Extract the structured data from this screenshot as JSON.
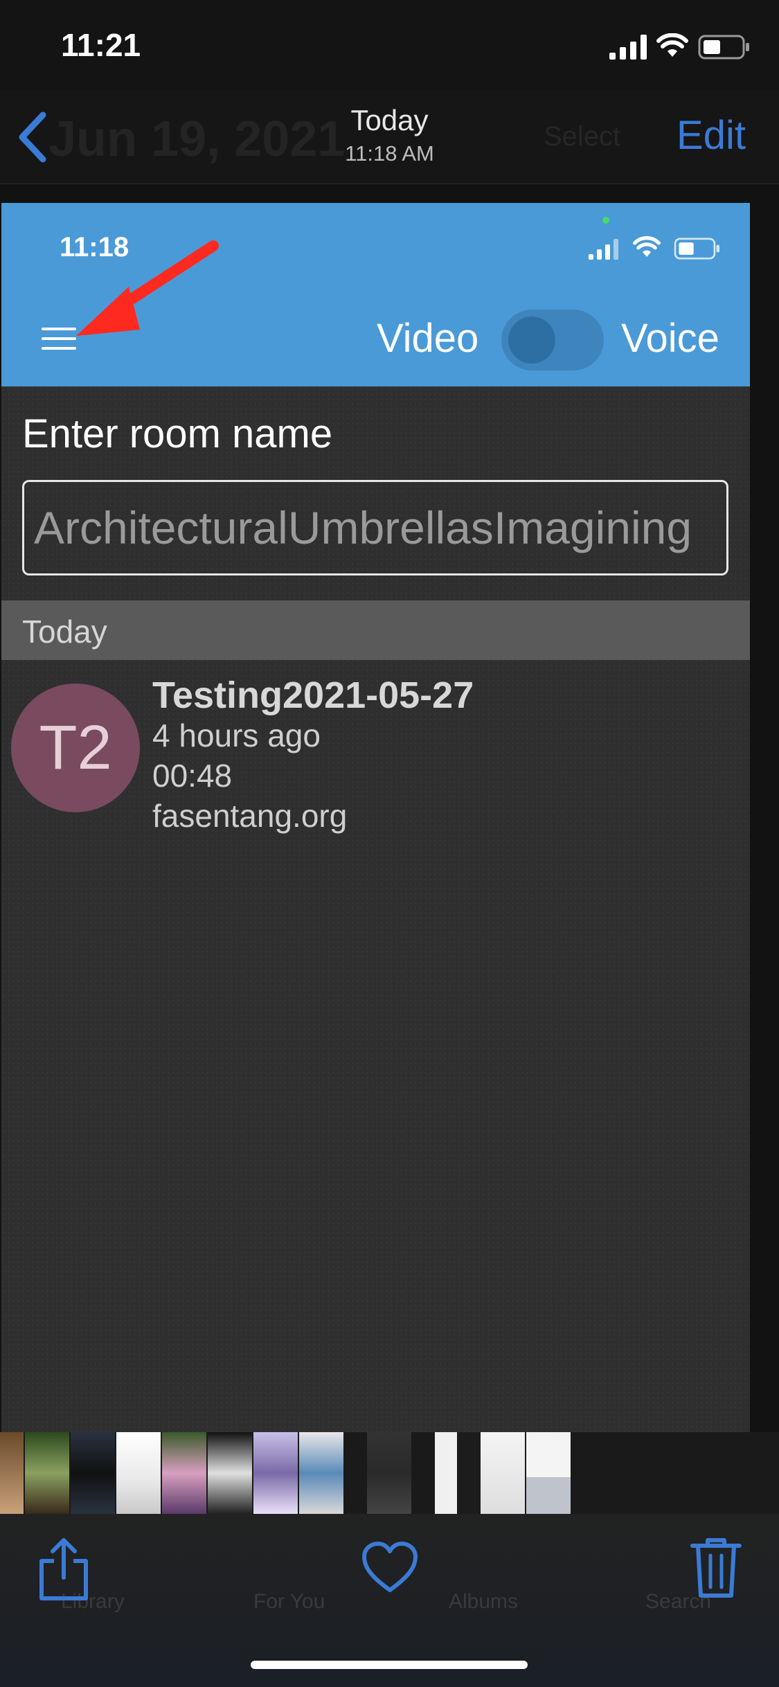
{
  "outer_status": {
    "time": "11:21"
  },
  "photos_nav": {
    "title": "Today",
    "subtitle": "11:18 AM",
    "edit_label": "Edit"
  },
  "app": {
    "status_time": "11:18",
    "mode_video": "Video",
    "mode_voice": "Voice",
    "room_label": "Enter room name",
    "room_input_value": "ArchitecturalUmbrellasImagining",
    "section_label": "Today",
    "history": [
      {
        "initials": "T2",
        "title": "Testing2021-05-27",
        "when": "4 hours ago",
        "duration": "00:48",
        "server": "fasentang.org"
      }
    ]
  },
  "colors": {
    "header_blue": "#4a9ad8",
    "ios_blue": "#3a7bd5",
    "arrow_red": "#ff2a1f",
    "avatar": "#7a4a5e"
  },
  "icons": [
    "back-chevron-icon",
    "signal-icon",
    "wifi-icon",
    "battery-icon",
    "menu-icon",
    "share-icon",
    "heart-icon",
    "trash-icon"
  ]
}
